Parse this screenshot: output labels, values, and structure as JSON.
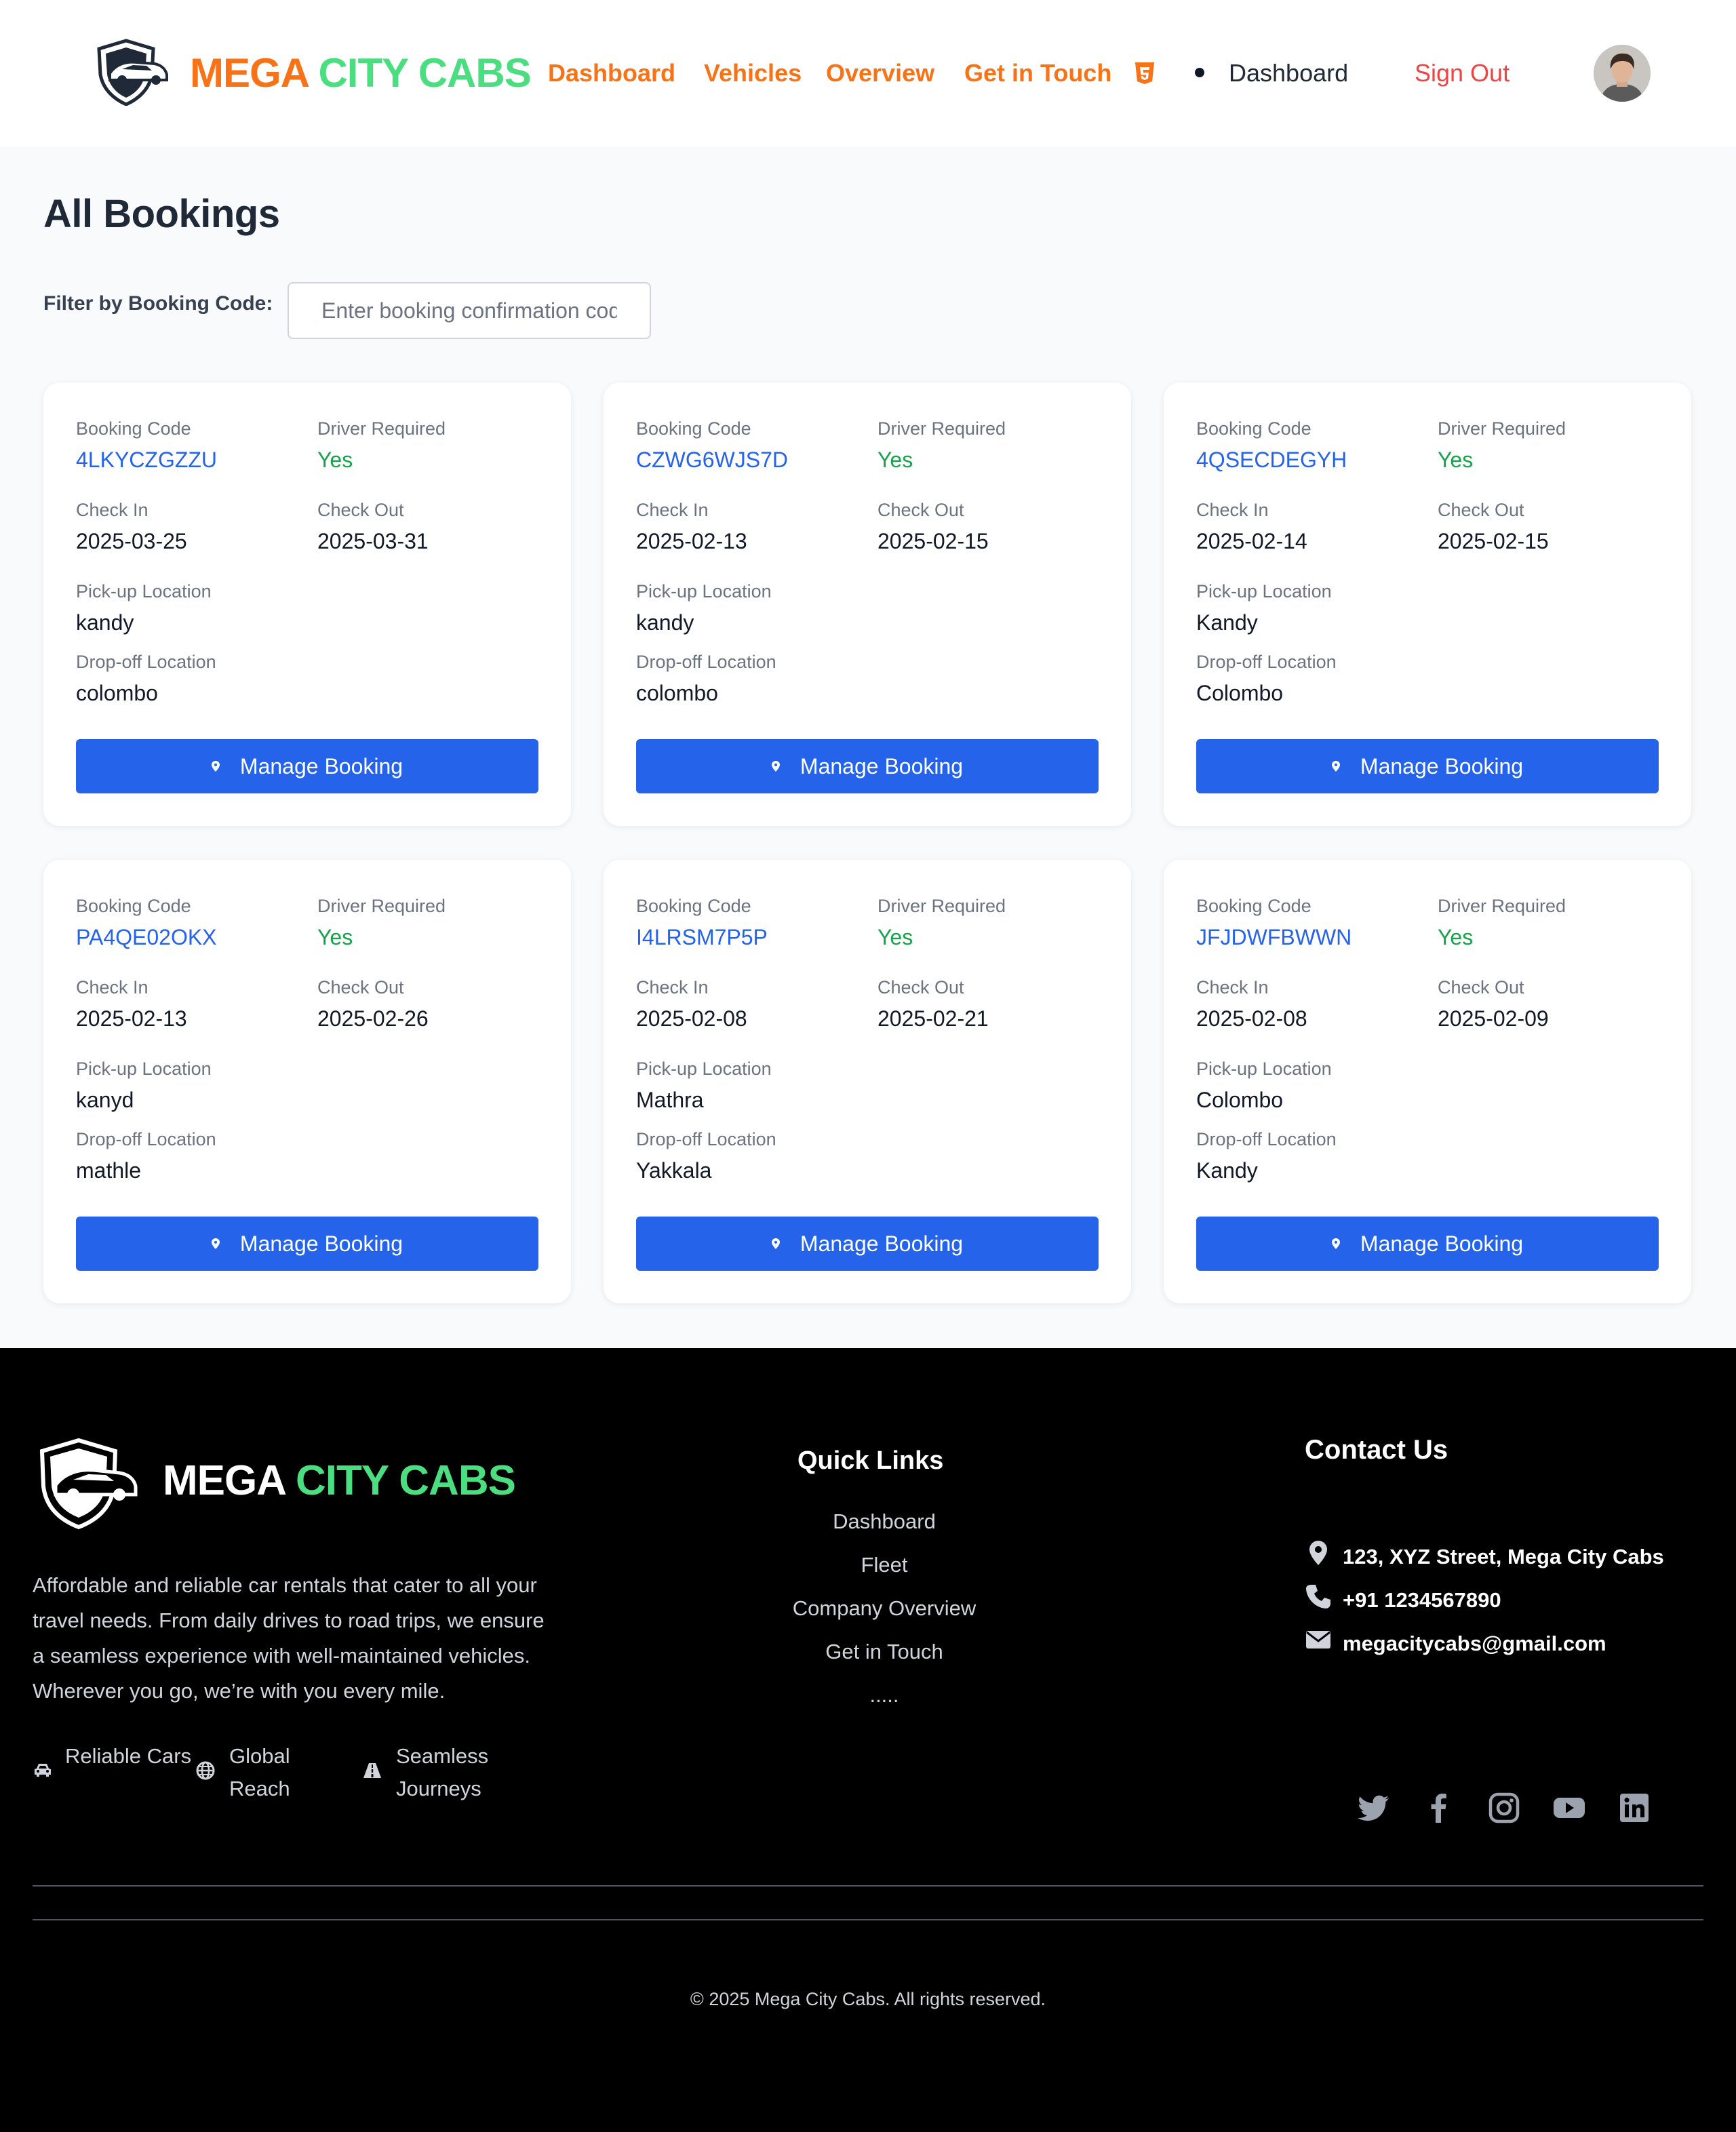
{
  "header": {
    "brand_part1": "MEGA",
    "brand_part2": "CITY CABS",
    "nav": {
      "dashboard": "Dashboard",
      "vehicles": "Vehicles",
      "overview": "Overview",
      "get_in_touch": "Get in Touch"
    },
    "current_page": "Dashboard",
    "sign_out": "Sign Out",
    "icons": [
      "car-shield-logo-icon",
      "html5-icon",
      "user-avatar"
    ]
  },
  "main": {
    "title": "All Bookings",
    "filter": {
      "label": "Filter by Booking Code:",
      "placeholder": "Enter booking confirmation code",
      "value": ""
    },
    "labels": {
      "booking_code": "Booking Code",
      "driver_required": "Driver Required",
      "check_in": "Check In",
      "check_out": "Check Out",
      "pickup": "Pick-up Location",
      "dropoff": "Drop-off Location",
      "manage": "Manage Booking"
    },
    "bookings": [
      {
        "code": "4LKYCZGZZU",
        "driver": "Yes",
        "check_in": "2025-03-25",
        "check_out": "2025-03-31",
        "pickup": "kandy",
        "dropoff": "colombo"
      },
      {
        "code": "CZWG6WJS7D",
        "driver": "Yes",
        "check_in": "2025-02-13",
        "check_out": "2025-02-15",
        "pickup": "kandy",
        "dropoff": "colombo"
      },
      {
        "code": "4QSECDEGYH",
        "driver": "Yes",
        "check_in": "2025-02-14",
        "check_out": "2025-02-15",
        "pickup": "Kandy",
        "dropoff": "Colombo"
      },
      {
        "code": "PA4QE02OKX",
        "driver": "Yes",
        "check_in": "2025-02-13",
        "check_out": "2025-02-26",
        "pickup": "kanyd",
        "dropoff": "mathle"
      },
      {
        "code": "I4LRSM7P5P",
        "driver": "Yes",
        "check_in": "2025-02-08",
        "check_out": "2025-02-21",
        "pickup": "Mathra",
        "dropoff": "Yakkala"
      },
      {
        "code": "JFJDWFBWWN",
        "driver": "Yes",
        "check_in": "2025-02-08",
        "check_out": "2025-02-09",
        "pickup": "Colombo",
        "dropoff": "Kandy"
      }
    ]
  },
  "footer": {
    "brand_part1": "MEGA",
    "brand_part2": "CITY CABS",
    "description": "Affordable and reliable car rentals that cater to all your travel needs. From daily drives to road trips, we ensure a seamless experience with well-maintained vehicles. Wherever you go, we’re with you every mile.",
    "features": [
      {
        "icon": "car-icon",
        "label": "Reliable Cars"
      },
      {
        "icon": "globe-icon",
        "label": "Global Reach"
      },
      {
        "icon": "road-icon",
        "label": "Seamless Journeys"
      }
    ],
    "quick_links_title": "Quick Links",
    "quick_links": [
      "Dashboard",
      "Fleet",
      "Company Overview",
      "Get in Touch",
      "....."
    ],
    "contact_title": "Contact Us",
    "contact": {
      "address": "123, XYZ Street, Mega City Cabs",
      "phone": "+91 1234567890",
      "email": "megacitycabs@gmail.com"
    },
    "social_icons": [
      "twitter-icon",
      "facebook-icon",
      "instagram-icon",
      "youtube-icon",
      "linkedin-icon"
    ],
    "copyright": "© 2025 Mega City Cabs. All rights reserved."
  },
  "colors": {
    "brand_orange": "#f97316",
    "brand_green": "#4ade80",
    "primary_blue": "#2563eb",
    "success_green": "#16a34a",
    "danger_red": "#ef4444"
  }
}
